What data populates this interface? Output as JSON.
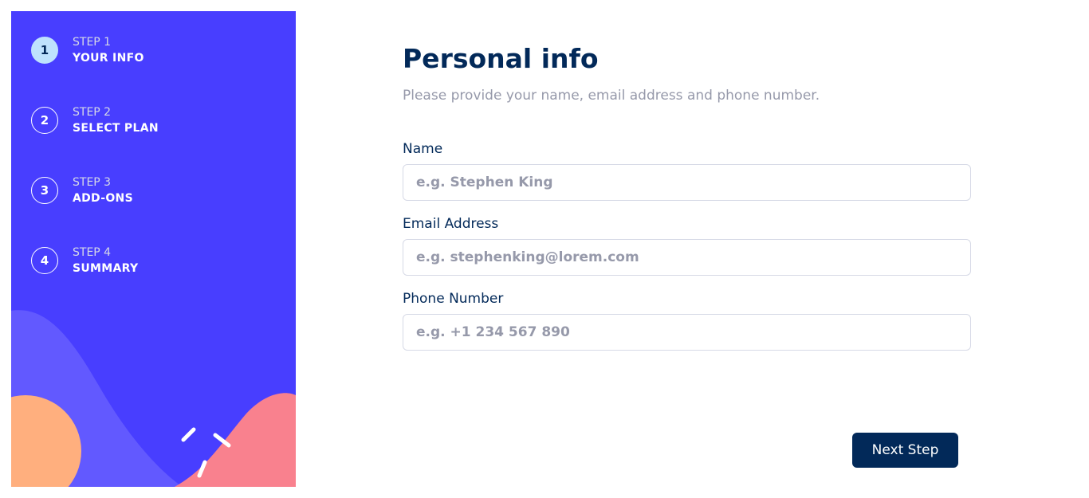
{
  "sidebar": {
    "steps": [
      {
        "number": "1",
        "label": "STEP 1",
        "name": "YOUR INFO",
        "active": true
      },
      {
        "number": "2",
        "label": "STEP 2",
        "name": "SELECT PLAN",
        "active": false
      },
      {
        "number": "3",
        "label": "STEP 3",
        "name": "ADD-ONS",
        "active": false
      },
      {
        "number": "4",
        "label": "STEP 4",
        "name": "SUMMARY",
        "active": false
      }
    ]
  },
  "form": {
    "title": "Personal info",
    "subtitle": "Please provide your name, email address and phone number.",
    "fields": {
      "name": {
        "label": "Name",
        "placeholder": "e.g. Stephen King",
        "value": ""
      },
      "email": {
        "label": "Email Address",
        "placeholder": "e.g. stephenking@lorem.com",
        "value": ""
      },
      "phone": {
        "label": "Phone Number",
        "placeholder": "e.g. +1 234 567 890",
        "value": ""
      }
    },
    "next_label": "Next Step"
  },
  "colors": {
    "sidebar_bg": "#483eff",
    "active_step_bg": "#bee2fd",
    "primary_text": "#022959",
    "muted_text": "#9699aa",
    "border": "#d6d9e6",
    "blob_purple": "#6259ff",
    "blob_orange": "#ffaf7e",
    "blob_pink": "#f9818e"
  }
}
